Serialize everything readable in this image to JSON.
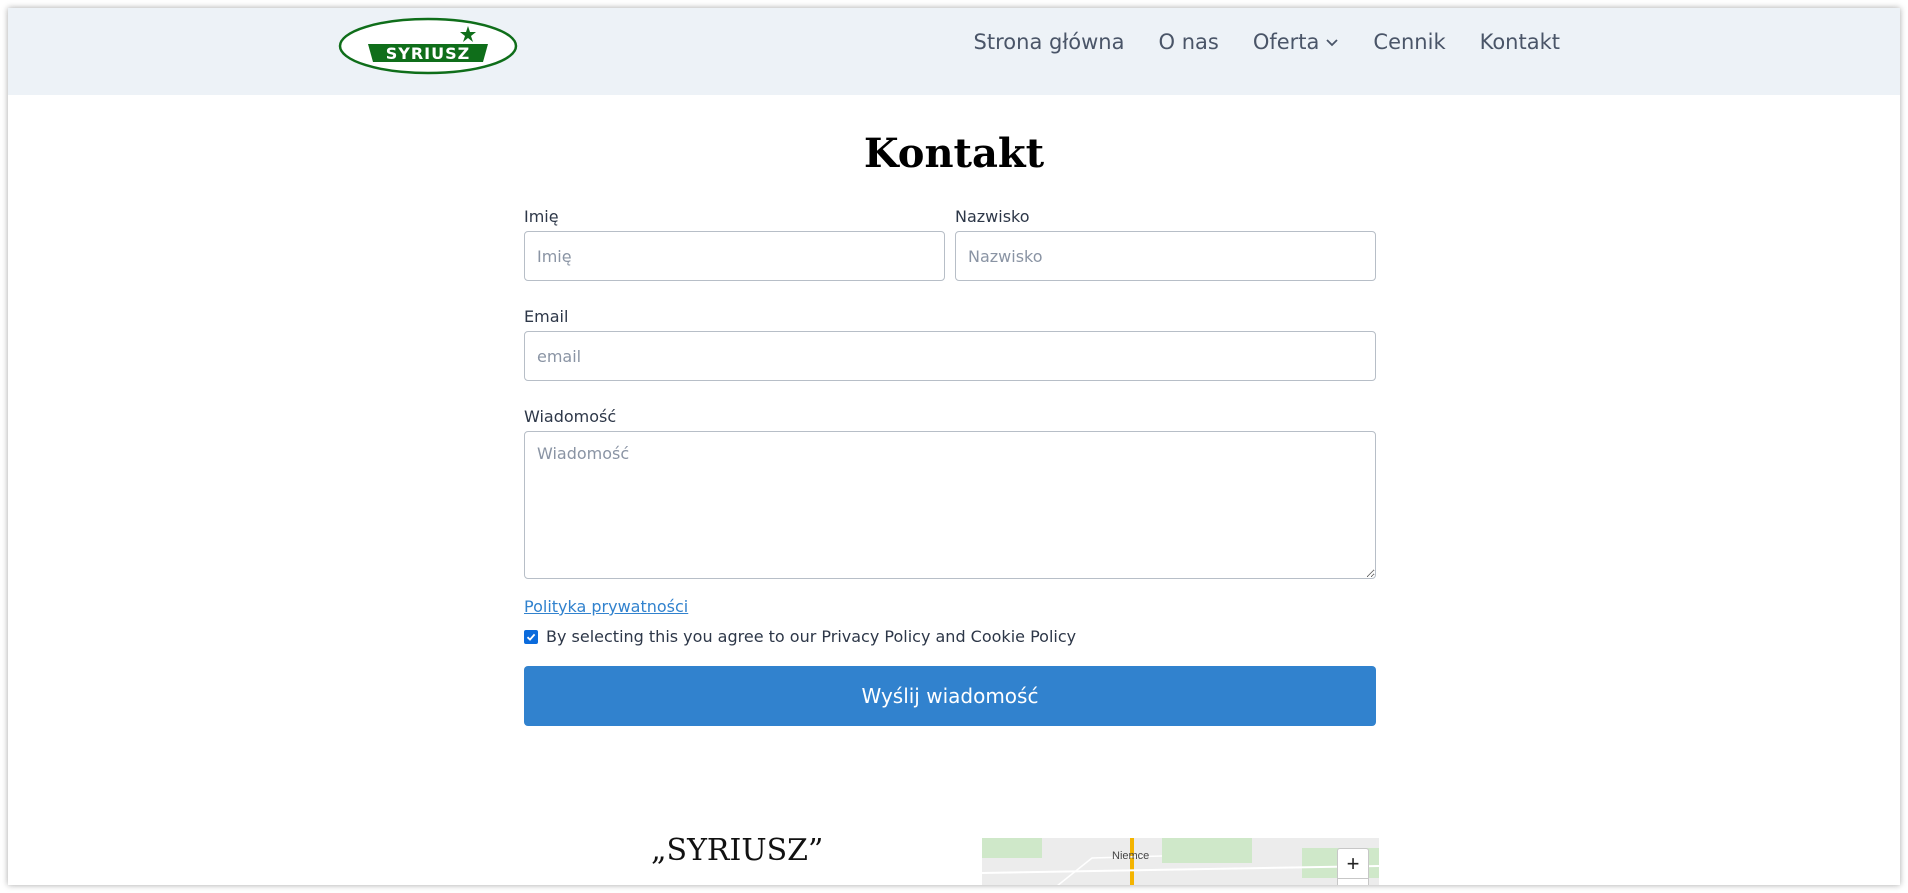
{
  "brand": {
    "logo_text": "SYRIUSZ",
    "logo_color": "#0f6e1a"
  },
  "nav": {
    "items": [
      {
        "label": "Strona główna"
      },
      {
        "label": "O nas"
      },
      {
        "label": "Oferta",
        "has_dropdown": true,
        "icon": "chevron-down-icon"
      },
      {
        "label": "Cennik"
      },
      {
        "label": "Kontakt"
      }
    ]
  },
  "page": {
    "title": "Kontakt"
  },
  "form": {
    "first_name": {
      "label": "Imię",
      "placeholder": "Imię"
    },
    "last_name": {
      "label": "Nazwisko",
      "placeholder": "Nazwisko"
    },
    "email": {
      "label": "Email",
      "placeholder": "email"
    },
    "message": {
      "label": "Wiadomość",
      "placeholder": "Wiadomość"
    },
    "privacy_link": "Polityka prywatności",
    "consent_label": "By selecting this you agree to our Privacy Policy and Cookie Policy",
    "consent_checked": true,
    "submit_label": "Wyślij wiadomość"
  },
  "footer": {
    "company_name": "„SYRIUSZ”",
    "map": {
      "city_label": "Niemce",
      "zoom_in": "+",
      "zoom_out": "−"
    }
  },
  "colors": {
    "header_bg": "#edf2f7",
    "accent": "#3182ce",
    "checkbox": "#0b6bdc"
  }
}
